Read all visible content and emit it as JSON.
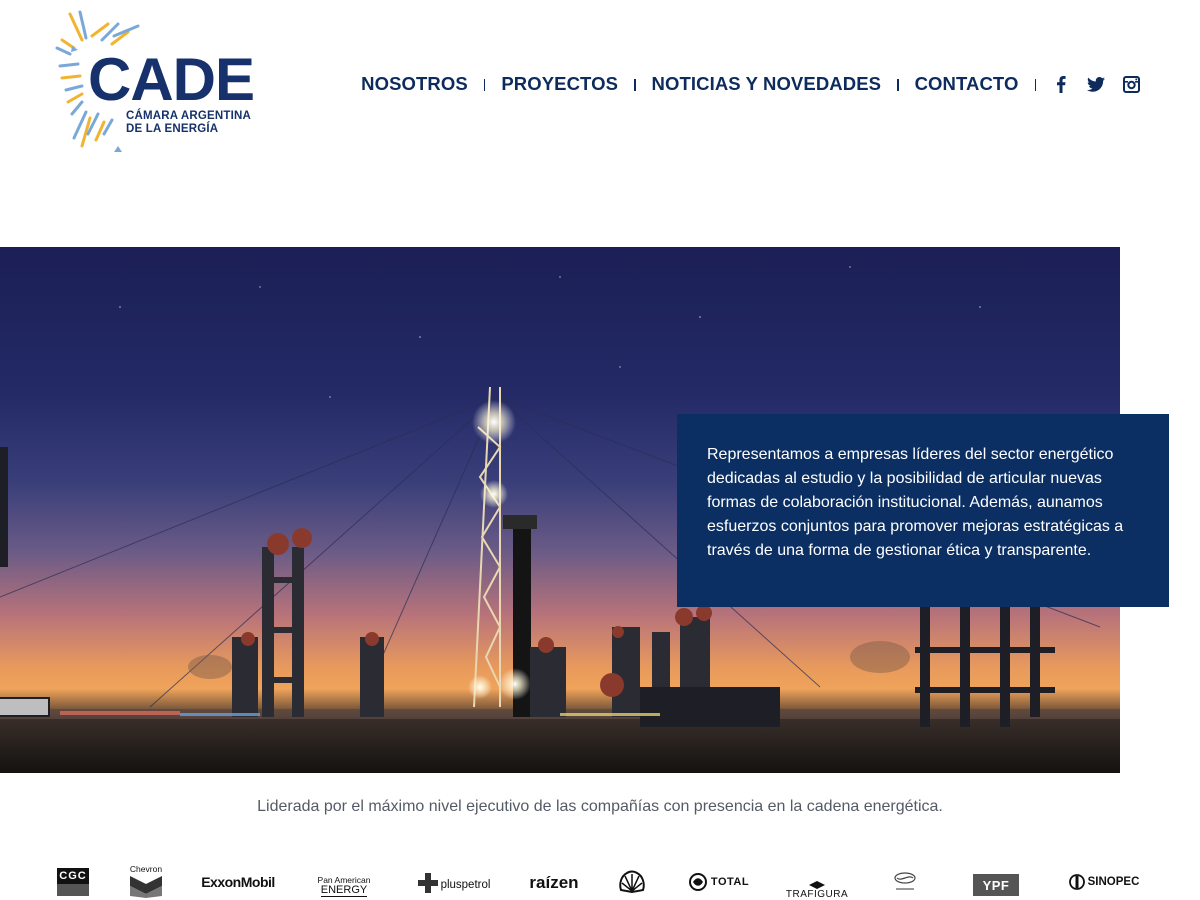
{
  "logo": {
    "word": "CADE",
    "subtitle_line1": "CÁMARA ARGENTINA",
    "subtitle_line2": "DE LA ENERGÍA"
  },
  "nav": {
    "items": [
      {
        "label": "NOSOTROS"
      },
      {
        "label": "PROYECTOS"
      },
      {
        "label": "NOTICIAS Y NOVEDADES"
      },
      {
        "label": "CONTACTO"
      }
    ],
    "social": [
      {
        "icon": "facebook-icon"
      },
      {
        "icon": "twitter-icon"
      },
      {
        "icon": "instagram-icon"
      }
    ]
  },
  "hero": {
    "text": "Representamos a empresas líderes del sector energético dedicadas al estudio y la posibilidad de articular nuevas formas de colaboración institucional. Además, aunamos esfuerzos conjuntos para promover mejoras estratégicas a través de una forma de gestionar ética y transparente."
  },
  "tagline": "Liderada por el máximo nivel ejecutivo de las compañías con presencia en la cadena energética.",
  "sponsors": [
    {
      "name": "CGC"
    },
    {
      "name": "Chevron"
    },
    {
      "name": "ExxonMobil"
    },
    {
      "name": "Pan American",
      "name2": "ENERGY"
    },
    {
      "name": "pluspetrol"
    },
    {
      "name": "raízen"
    },
    {
      "name": "Shell",
      "icon": "shell-logo-icon"
    },
    {
      "name": "TOTAL"
    },
    {
      "name": "TRAFIGURA"
    },
    {
      "name": "wintershall dea",
      "icon": "wintershall-logo-icon"
    },
    {
      "name": "YPF"
    },
    {
      "name": "SINOPEC"
    }
  ],
  "colors": {
    "navy": "#0b2f63",
    "nav_text": "#0d2b5c",
    "tagline": "#555b66",
    "logo_yellow": "#f2b430",
    "logo_blue": "#7aa9d8"
  }
}
